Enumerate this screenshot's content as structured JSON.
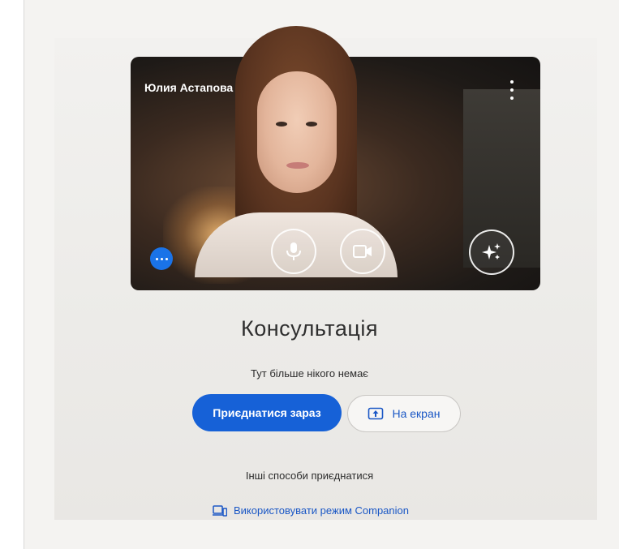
{
  "preview": {
    "participant_name": "Юлия Астапова",
    "controls": {
      "mic_icon": "microphone-icon",
      "camera_icon": "video-camera-icon",
      "effects_icon": "sparkle-effects-icon",
      "more_icon": "more-options-icon",
      "kebab_icon": "vertical-dots-icon"
    }
  },
  "meeting": {
    "title": "Консультація",
    "status": "Тут більше нікого немає"
  },
  "actions": {
    "join_label": "Приєднатися зараз",
    "present_label": "На екран",
    "present_icon": "present-screen-icon"
  },
  "other": {
    "heading": "Інші способи приєднатися",
    "companion_label": "Використовувати режим Companion",
    "companion_icon": "companion-devices-icon"
  },
  "colors": {
    "primary": "#1661d7",
    "link": "#1a57c5"
  }
}
